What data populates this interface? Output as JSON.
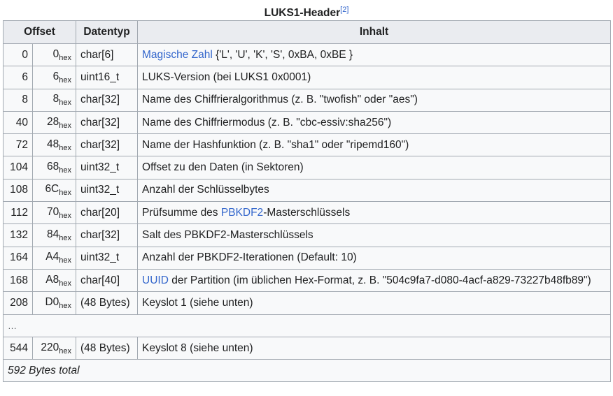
{
  "caption": {
    "title": "LUKS1-Header",
    "ref": "[2]"
  },
  "headers": {
    "offset": "Offset",
    "datatype": "Datentyp",
    "content": "Inhalt"
  },
  "hex_suffix": "hex",
  "rows": [
    {
      "dec": "0",
      "hex": "0",
      "type": "char[6]",
      "link": "Magische Zahl",
      "content": " {'L', 'U', 'K', 'S', 0xBA, 0xBE }"
    },
    {
      "dec": "6",
      "hex": "6",
      "type": "uint16_t",
      "content": "LUKS-Version (bei LUKS1 0x0001)"
    },
    {
      "dec": "8",
      "hex": "8",
      "type": "char[32]",
      "content": "Name des Chiffrieralgorithmus (z. B. \"twofish\" oder \"aes\")"
    },
    {
      "dec": "40",
      "hex": "28",
      "type": "char[32]",
      "content": "Name des Chiffriermodus (z. B. \"cbc-essiv:sha256\")"
    },
    {
      "dec": "72",
      "hex": "48",
      "type": "char[32]",
      "content": "Name der Hashfunktion (z. B. \"sha1\" oder \"ripemd160\")"
    },
    {
      "dec": "104",
      "hex": "68",
      "type": "uint32_t",
      "content": "Offset zu den Daten (in Sektoren)"
    },
    {
      "dec": "108",
      "hex": "6C",
      "type": "uint32_t",
      "content": "Anzahl der Schlüsselbytes"
    },
    {
      "dec": "112",
      "hex": "70",
      "type": "char[20]",
      "prefix": "Prüfsumme des ",
      "link": "PBKDF2",
      "content": "-Masterschlüssels"
    },
    {
      "dec": "132",
      "hex": "84",
      "type": "char[32]",
      "content": "Salt des PBKDF2-Masterschlüssels"
    },
    {
      "dec": "164",
      "hex": "A4",
      "type": "uint32_t",
      "content": "Anzahl der PBKDF2-Iterationen (Default: 10)"
    },
    {
      "dec": "168",
      "hex": "A8",
      "type": "char[40]",
      "link": "UUID",
      "content": " der Partition (im üblichen Hex-Format, z. B. \"504c9fa7-d080-4acf-a829-73227b48fb89\")"
    },
    {
      "dec": "208",
      "hex": "D0",
      "type": "(48 Bytes)",
      "content": "Keyslot 1 (siehe unten)"
    }
  ],
  "ellipsis": "…",
  "last_row": {
    "dec": "544",
    "hex": "220",
    "type": "(48 Bytes)",
    "content": "Keyslot 8 (siehe unten)"
  },
  "total": "592 Bytes total"
}
